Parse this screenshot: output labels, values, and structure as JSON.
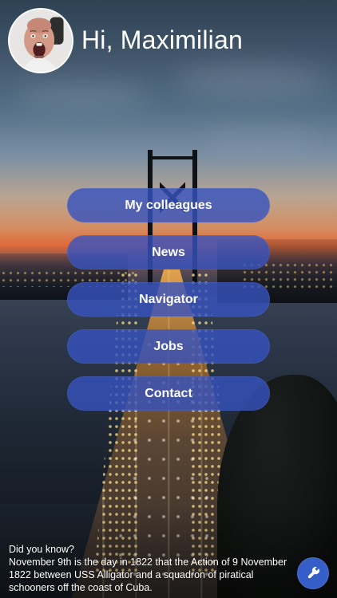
{
  "header": {
    "greeting": "Hi, Maximilian",
    "avatar_icon": "profile-photo"
  },
  "menu": {
    "items": [
      {
        "label": "My colleagues"
      },
      {
        "label": "News"
      },
      {
        "label": "Navigator"
      },
      {
        "label": "Jobs"
      },
      {
        "label": "Contact"
      }
    ]
  },
  "fact": {
    "title": "Did you know?",
    "text": "November 9th is the day in 1822 that the Action of 9 November 1822 between USS Alligator and a squadron of piratical schooners off the coast of Cuba."
  },
  "actions": {
    "settings_icon": "wrench-icon"
  },
  "colors": {
    "button_fill": "#3652BF",
    "settings_fill": "#355EC8",
    "text": "#FFFFFF"
  }
}
